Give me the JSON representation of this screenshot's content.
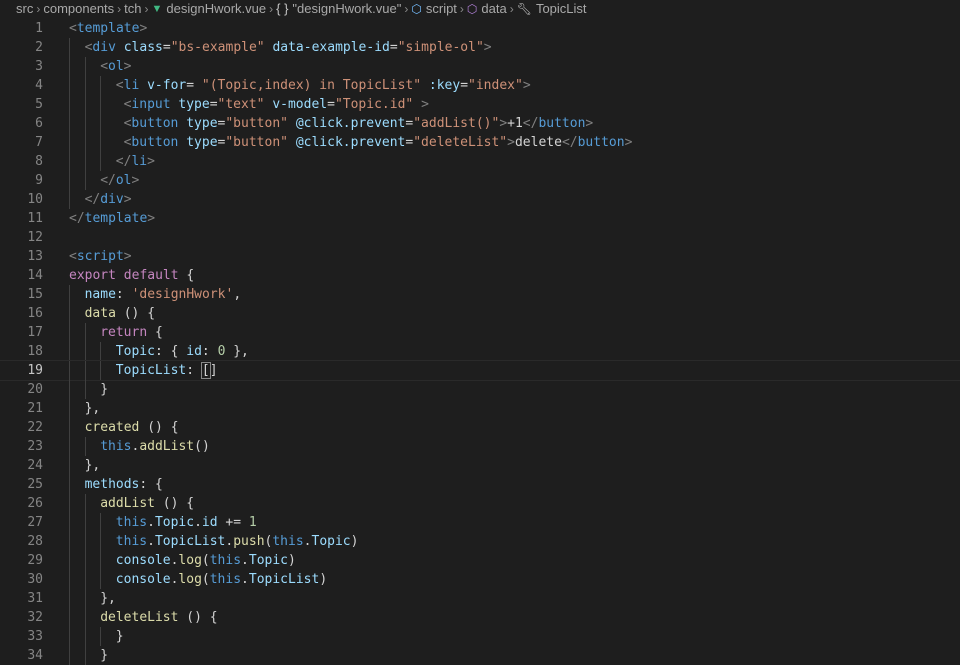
{
  "breadcrumb": [
    {
      "label": "src",
      "icon": ""
    },
    {
      "label": "components",
      "icon": ""
    },
    {
      "label": "tch",
      "icon": ""
    },
    {
      "label": "designHwork.vue",
      "icon": "vue-logo-icon"
    },
    {
      "label": "\"designHwork.vue\"",
      "icon": "braces-icon"
    },
    {
      "label": "script",
      "icon": "cube-icon"
    },
    {
      "label": "data",
      "icon": "cube-icon"
    },
    {
      "label": "TopicList",
      "icon": "wrench-icon"
    }
  ],
  "editor": {
    "current_line": 19,
    "lines": [
      {
        "n": "1",
        "indent": 0,
        "tokens": [
          [
            "t-tag",
            "<"
          ],
          [
            "t-name",
            "template"
          ],
          [
            "t-tag",
            ">"
          ]
        ]
      },
      {
        "n": "2",
        "indent": 1,
        "tokens": [
          [
            "t-tag",
            "<"
          ],
          [
            "t-name",
            "div"
          ],
          [
            "t-txt",
            " "
          ],
          [
            "t-attr",
            "class"
          ],
          [
            "t-txt",
            "="
          ],
          [
            "t-str",
            "\"bs-example\""
          ],
          [
            "t-txt",
            " "
          ],
          [
            "t-attr",
            "data-example-id"
          ],
          [
            "t-txt",
            "="
          ],
          [
            "t-str",
            "\"simple-ol\""
          ],
          [
            "t-tag",
            ">"
          ]
        ]
      },
      {
        "n": "3",
        "indent": 2,
        "tokens": [
          [
            "t-tag",
            "<"
          ],
          [
            "t-name",
            "ol"
          ],
          [
            "t-tag",
            ">"
          ]
        ]
      },
      {
        "n": "4",
        "indent": 3,
        "tokens": [
          [
            "t-tag",
            "<"
          ],
          [
            "t-name",
            "li"
          ],
          [
            "t-txt",
            " "
          ],
          [
            "t-attr",
            "v-for"
          ],
          [
            "t-txt",
            "= "
          ],
          [
            "t-str",
            "\"(Topic,index) in TopicList\""
          ],
          [
            "t-txt",
            " "
          ],
          [
            "t-attr",
            ":key"
          ],
          [
            "t-txt",
            "="
          ],
          [
            "t-str",
            "\"index\""
          ],
          [
            "t-tag",
            ">"
          ]
        ]
      },
      {
        "n": "5",
        "indent": 3.5,
        "tokens": [
          [
            "t-tag",
            "<"
          ],
          [
            "t-name",
            "input"
          ],
          [
            "t-txt",
            " "
          ],
          [
            "t-attr",
            "type"
          ],
          [
            "t-txt",
            "="
          ],
          [
            "t-str",
            "\"text\""
          ],
          [
            "t-txt",
            " "
          ],
          [
            "t-attr",
            "v-model"
          ],
          [
            "t-txt",
            "="
          ],
          [
            "t-str",
            "\"Topic.id\""
          ],
          [
            "t-txt",
            " "
          ],
          [
            "t-tag",
            ">"
          ]
        ]
      },
      {
        "n": "6",
        "indent": 3.5,
        "tokens": [
          [
            "t-tag",
            "<"
          ],
          [
            "t-name",
            "button"
          ],
          [
            "t-txt",
            " "
          ],
          [
            "t-attr",
            "type"
          ],
          [
            "t-txt",
            "="
          ],
          [
            "t-str",
            "\"button\""
          ],
          [
            "t-txt",
            " "
          ],
          [
            "t-attr",
            "@click.prevent"
          ],
          [
            "t-txt",
            "="
          ],
          [
            "t-str",
            "\"addList()\""
          ],
          [
            "t-tag",
            ">"
          ],
          [
            "t-txt",
            "+1"
          ],
          [
            "t-tag",
            "</"
          ],
          [
            "t-name",
            "button"
          ],
          [
            "t-tag",
            ">"
          ]
        ]
      },
      {
        "n": "7",
        "indent": 3.5,
        "tokens": [
          [
            "t-tag",
            "<"
          ],
          [
            "t-name",
            "button"
          ],
          [
            "t-txt",
            " "
          ],
          [
            "t-attr",
            "type"
          ],
          [
            "t-txt",
            "="
          ],
          [
            "t-str",
            "\"button\""
          ],
          [
            "t-txt",
            " "
          ],
          [
            "t-attr",
            "@click.prevent"
          ],
          [
            "t-txt",
            "="
          ],
          [
            "t-str",
            "\"deleteList\""
          ],
          [
            "t-tag",
            ">"
          ],
          [
            "t-txt",
            "delete"
          ],
          [
            "t-tag",
            "</"
          ],
          [
            "t-name",
            "button"
          ],
          [
            "t-tag",
            ">"
          ]
        ]
      },
      {
        "n": "8",
        "indent": 3,
        "tokens": [
          [
            "t-tag",
            "</"
          ],
          [
            "t-name",
            "li"
          ],
          [
            "t-tag",
            ">"
          ]
        ]
      },
      {
        "n": "9",
        "indent": 2,
        "tokens": [
          [
            "t-tag",
            "</"
          ],
          [
            "t-name",
            "ol"
          ],
          [
            "t-tag",
            ">"
          ]
        ]
      },
      {
        "n": "10",
        "indent": 1,
        "tokens": [
          [
            "t-tag",
            "</"
          ],
          [
            "t-name",
            "div"
          ],
          [
            "t-tag",
            ">"
          ]
        ]
      },
      {
        "n": "11",
        "indent": 0,
        "tokens": [
          [
            "t-tag",
            "</"
          ],
          [
            "t-name",
            "template"
          ],
          [
            "t-tag",
            ">"
          ]
        ]
      },
      {
        "n": "12",
        "indent": 0,
        "tokens": []
      },
      {
        "n": "13",
        "indent": 0,
        "tokens": [
          [
            "t-tag",
            "<"
          ],
          [
            "t-name",
            "script"
          ],
          [
            "t-tag",
            ">"
          ]
        ]
      },
      {
        "n": "14",
        "indent": 0,
        "tokens": [
          [
            "t-kw",
            "export"
          ],
          [
            "t-txt",
            " "
          ],
          [
            "t-kw",
            "default"
          ],
          [
            "t-txt",
            " {"
          ]
        ]
      },
      {
        "n": "15",
        "indent": 1,
        "tokens": [
          [
            "t-prop",
            "name"
          ],
          [
            "t-txt",
            ": "
          ],
          [
            "t-str",
            "'designHwork'"
          ],
          [
            "t-txt",
            ","
          ]
        ]
      },
      {
        "n": "16",
        "indent": 1,
        "tokens": [
          [
            "t-fn",
            "data"
          ],
          [
            "t-txt",
            " () {"
          ]
        ]
      },
      {
        "n": "17",
        "indent": 2,
        "tokens": [
          [
            "t-kw",
            "return"
          ],
          [
            "t-txt",
            " {"
          ]
        ]
      },
      {
        "n": "18",
        "indent": 3,
        "tokens": [
          [
            "t-prop",
            "Topic"
          ],
          [
            "t-txt",
            ": { "
          ],
          [
            "t-prop",
            "id"
          ],
          [
            "t-txt",
            ": "
          ],
          [
            "t-num",
            "0"
          ],
          [
            "t-txt",
            " },"
          ]
        ]
      },
      {
        "n": "19",
        "indent": 3,
        "tokens": [
          [
            "t-prop",
            "TopicList"
          ],
          [
            "t-txt",
            ": "
          ],
          [
            "t-txt cursor-bracket",
            "["
          ],
          [
            "t-txt",
            "]"
          ]
        ]
      },
      {
        "n": "20",
        "indent": 2,
        "tokens": [
          [
            "t-txt",
            "}"
          ]
        ]
      },
      {
        "n": "21",
        "indent": 1,
        "tokens": [
          [
            "t-txt",
            "},"
          ]
        ]
      },
      {
        "n": "22",
        "indent": 1,
        "tokens": [
          [
            "t-fn",
            "created"
          ],
          [
            "t-txt",
            " () {"
          ]
        ]
      },
      {
        "n": "23",
        "indent": 2,
        "tokens": [
          [
            "t-this",
            "this"
          ],
          [
            "t-txt",
            "."
          ],
          [
            "t-fn",
            "addList"
          ],
          [
            "t-txt",
            "()"
          ]
        ]
      },
      {
        "n": "24",
        "indent": 1,
        "tokens": [
          [
            "t-txt",
            "},"
          ]
        ]
      },
      {
        "n": "25",
        "indent": 1,
        "tokens": [
          [
            "t-prop",
            "methods"
          ],
          [
            "t-txt",
            ": {"
          ]
        ]
      },
      {
        "n": "26",
        "indent": 2,
        "tokens": [
          [
            "t-fn",
            "addList"
          ],
          [
            "t-txt",
            " () {"
          ]
        ]
      },
      {
        "n": "27",
        "indent": 3,
        "tokens": [
          [
            "t-this",
            "this"
          ],
          [
            "t-txt",
            "."
          ],
          [
            "t-prop",
            "Topic"
          ],
          [
            "t-txt",
            "."
          ],
          [
            "t-prop",
            "id"
          ],
          [
            "t-txt",
            " += "
          ],
          [
            "t-num",
            "1"
          ]
        ]
      },
      {
        "n": "28",
        "indent": 3,
        "tokens": [
          [
            "t-this",
            "this"
          ],
          [
            "t-txt",
            "."
          ],
          [
            "t-prop",
            "TopicList"
          ],
          [
            "t-txt",
            "."
          ],
          [
            "t-fn",
            "push"
          ],
          [
            "t-txt",
            "("
          ],
          [
            "t-this",
            "this"
          ],
          [
            "t-txt",
            "."
          ],
          [
            "t-prop",
            "Topic"
          ],
          [
            "t-txt",
            ")"
          ]
        ]
      },
      {
        "n": "29",
        "indent": 3,
        "tokens": [
          [
            "t-prop",
            "console"
          ],
          [
            "t-txt",
            "."
          ],
          [
            "t-fn",
            "log"
          ],
          [
            "t-txt",
            "("
          ],
          [
            "t-this",
            "this"
          ],
          [
            "t-txt",
            "."
          ],
          [
            "t-prop",
            "Topic"
          ],
          [
            "t-txt",
            ")"
          ]
        ]
      },
      {
        "n": "30",
        "indent": 3,
        "tokens": [
          [
            "t-prop",
            "console"
          ],
          [
            "t-txt",
            "."
          ],
          [
            "t-fn",
            "log"
          ],
          [
            "t-txt",
            "("
          ],
          [
            "t-this",
            "this"
          ],
          [
            "t-txt",
            "."
          ],
          [
            "t-prop",
            "TopicList"
          ],
          [
            "t-txt",
            ")"
          ]
        ]
      },
      {
        "n": "31",
        "indent": 2,
        "tokens": [
          [
            "t-txt",
            "},"
          ]
        ]
      },
      {
        "n": "32",
        "indent": 2,
        "tokens": [
          [
            "t-fn",
            "deleteList"
          ],
          [
            "t-txt",
            " () {"
          ]
        ]
      },
      {
        "n": "33",
        "indent": 3,
        "tokens": [
          [
            "t-txt",
            "}"
          ]
        ]
      },
      {
        "n": "34",
        "indent": 2,
        "tokens": [
          [
            "t-txt",
            "}"
          ]
        ]
      }
    ]
  }
}
